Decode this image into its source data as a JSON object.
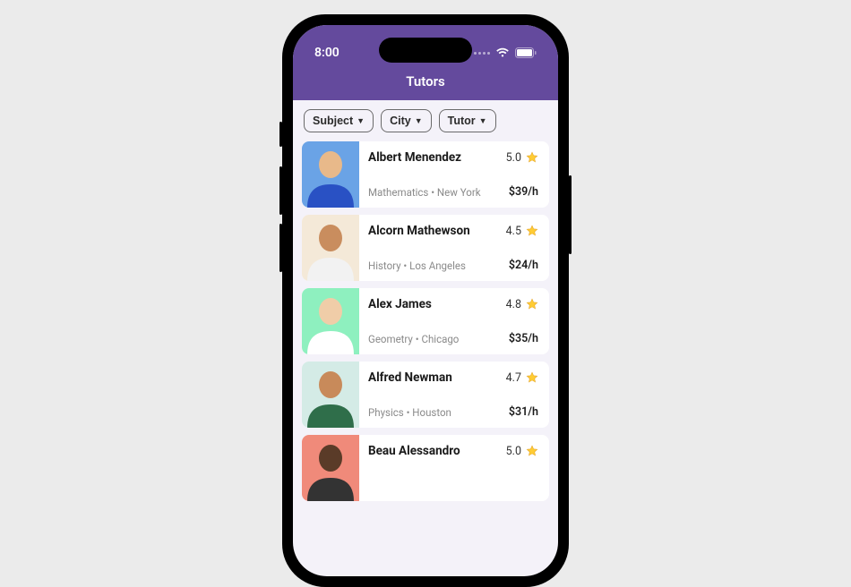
{
  "status": {
    "time": "8:00"
  },
  "header": {
    "title": "Tutors"
  },
  "filters": [
    {
      "label": "Subject"
    },
    {
      "label": "City"
    },
    {
      "label": "Tutor"
    }
  ],
  "tutors": [
    {
      "name": "Albert Menendez",
      "subject": "Mathematics",
      "city": "New York",
      "rating": "5.0",
      "price": "$39/h",
      "bg": "#6aa3e6"
    },
    {
      "name": "Alcorn Mathewson",
      "subject": "History",
      "city": "Los Angeles",
      "rating": "4.5",
      "price": "$24/h",
      "bg": "#f4e9d8"
    },
    {
      "name": "Alex James",
      "subject": "Geometry",
      "city": "Chicago",
      "rating": "4.8",
      "price": "$35/h",
      "bg": "#8ef0bf"
    },
    {
      "name": "Alfred Newman",
      "subject": "Physics",
      "city": "Houston",
      "rating": "4.7",
      "price": "$31/h",
      "bg": "#d4ebe6"
    },
    {
      "name": "Beau Alessandro",
      "subject": "",
      "city": "",
      "rating": "5.0",
      "price": "",
      "bg": "#f08a7a"
    }
  ]
}
